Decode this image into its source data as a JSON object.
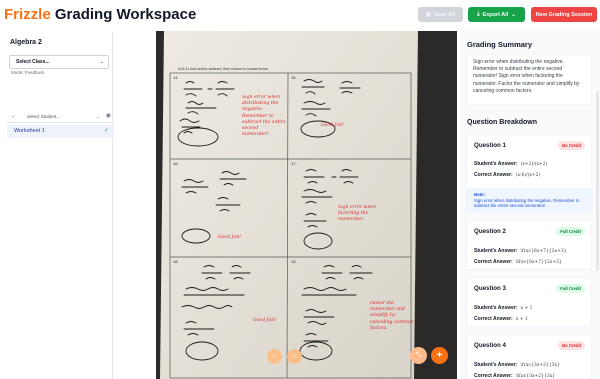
{
  "app": {
    "brand_accent": "Frizzle",
    "brand_rest": " Grading Workspace"
  },
  "toolbar": {
    "save_all": "Save All",
    "export_all": "Export All",
    "new_session": "New Grading Session"
  },
  "left": {
    "class_title": "Algebra 2",
    "select_class": "Select Class...",
    "mode_label": "Mode: Feedback",
    "select_student": "Select Student...",
    "worksheet": "Worksheet 1"
  },
  "paper": {
    "header": "#14-21  Add and/or subtract, then reduce to lowest terms.",
    "cells": [
      {
        "num": "14.",
        "feedback": "Sign error when distributing the negative. Remember to subtract the entire second numerator!"
      },
      {
        "num": "15.",
        "feedback": "Good Job!"
      },
      {
        "num": "16.",
        "feedback": "Good Job!"
      },
      {
        "num": "17.",
        "feedback": "Sign error when factoring the numerator."
      },
      {
        "num": "18.",
        "feedback": "Good Job!"
      },
      {
        "num": "19.",
        "feedback": "Factor the numerator and simplify by canceling common factors."
      }
    ]
  },
  "summary": {
    "title": "Grading Summary",
    "text": "Sign error when distributing the negative. Remember to subtract the entire second numerator! Sign error when factoring the numerator. Factor the numerator and simplify by canceling common factors."
  },
  "breakdown": {
    "title": "Question Breakdown",
    "student_label": "Student's Answer:",
    "correct_label": "Correct Answer:",
    "questions": [
      {
        "title": "Question 1",
        "badge": "No Credit",
        "student": "(x+2)/(x+2)",
        "correct": "(x-6)/(x+2)",
        "note_head": "Note:",
        "note": "Sign error when distributing the negative. Remember to subtract the entire second numerator!"
      },
      {
        "title": "Question 2",
        "badge": "Full Credit",
        "student": "\\frac{6x+7}{2x+3}",
        "correct": "\\frac{6x+7}{2x+3}"
      },
      {
        "title": "Question 3",
        "badge": "Full Credit",
        "student": "x + 1",
        "correct": "x + 1"
      },
      {
        "title": "Question 4",
        "badge": "No Credit",
        "student": "\\frac{3x+2}{3x}",
        "correct": "\\frac{3x+2}{3x}"
      }
    ]
  },
  "colors": {
    "brand": "#f97316",
    "export": "#16a34a",
    "new_session": "#ef4444",
    "feedback_ink": "#dc2626",
    "no_credit": "#dc2626",
    "full_credit": "#15803d"
  },
  "icons": {
    "export": "download-icon",
    "dropdown": "chevron-down-icon",
    "eye": "eye-icon",
    "check": "check-icon",
    "prev": "arrow-left-icon",
    "next": "arrow-right-icon",
    "expand": "expand-icon",
    "add": "plus-icon"
  }
}
